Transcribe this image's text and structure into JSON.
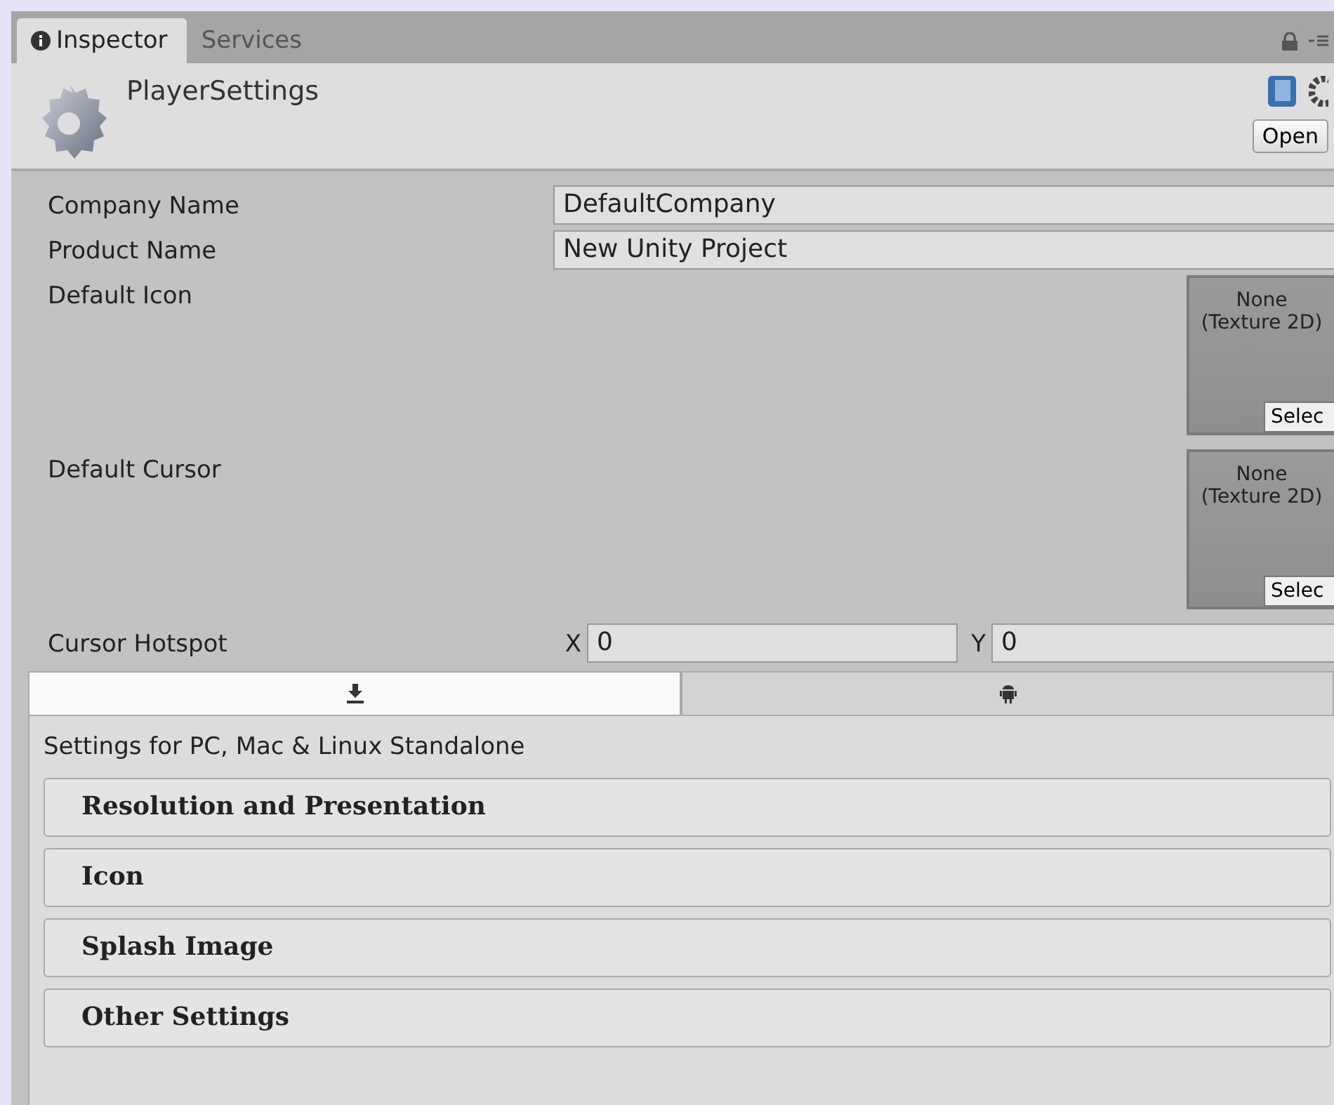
{
  "panel_tabs": [
    {
      "label": "Inspector",
      "selected": true
    },
    {
      "label": "Services",
      "selected": false
    }
  ],
  "header": {
    "title": "PlayerSettings",
    "open_button": "Open"
  },
  "fields": [
    {
      "kind": "text",
      "label": "Company Name",
      "value": "DefaultCompany"
    },
    {
      "kind": "text",
      "label": "Product Name",
      "value": "New Unity Project"
    },
    {
      "kind": "texture",
      "label": "Default Icon",
      "preview": "None (Texture 2D)",
      "button": "Selec"
    },
    {
      "kind": "texture",
      "label": "Default Cursor",
      "preview": "None (Texture 2D)",
      "button": "Selec"
    },
    {
      "kind": "vector2",
      "label": "Cursor Hotspot",
      "components": [
        {
          "axis": "X",
          "value": "0"
        },
        {
          "axis": "Y",
          "value": "0"
        }
      ]
    }
  ],
  "platform_tabs": [
    {
      "kind": "standalone",
      "selected": true
    },
    {
      "kind": "android",
      "selected": false
    }
  ],
  "platform_label": "Settings for PC, Mac & Linux Standalone",
  "sections": [
    "Resolution and Presentation",
    "Icon",
    "Splash Image",
    "Other Settings"
  ]
}
